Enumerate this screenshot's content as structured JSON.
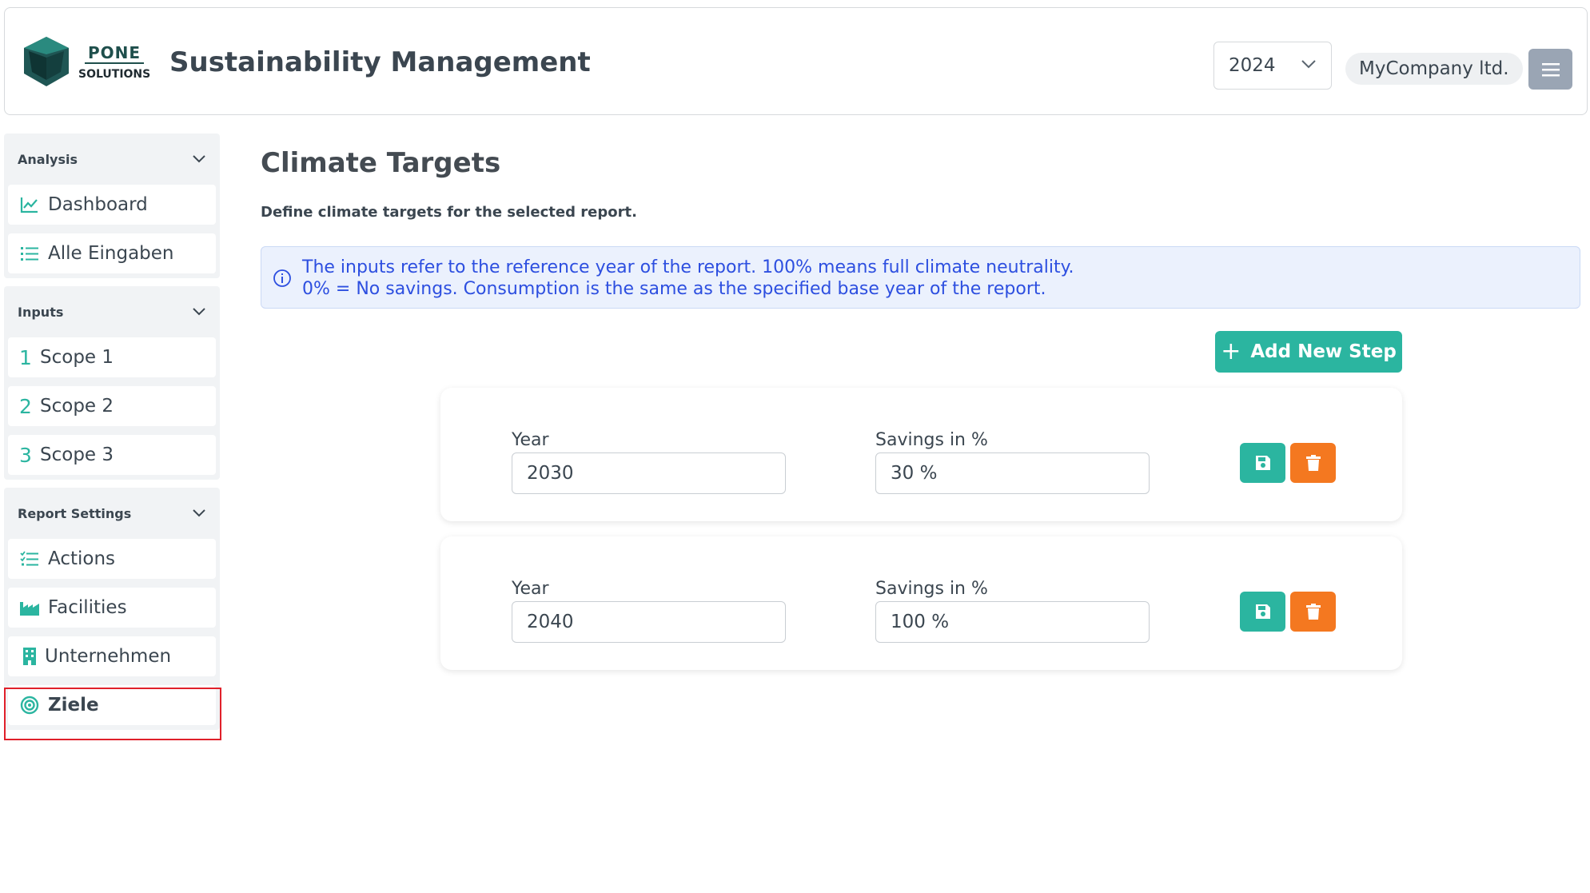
{
  "header": {
    "logo_top": "PONE",
    "logo_bottom": "SOLUTIONS",
    "title": "Sustainability Management",
    "year": "2024",
    "company": "MyCompany ltd."
  },
  "sidebar": {
    "sections": [
      {
        "title": "Analysis",
        "items": [
          {
            "label": "Dashboard",
            "icon": "chart-line-icon"
          },
          {
            "label": "Alle Eingaben",
            "icon": "list-icon"
          }
        ]
      },
      {
        "title": "Inputs",
        "items": [
          {
            "label": "Scope 1",
            "num": "1"
          },
          {
            "label": "Scope 2",
            "num": "2"
          },
          {
            "label": "Scope 3",
            "num": "3"
          }
        ]
      },
      {
        "title": "Report Settings",
        "items": [
          {
            "label": "Actions",
            "icon": "checklist-icon"
          },
          {
            "label": "Facilities",
            "icon": "industry-icon"
          },
          {
            "label": "Unternehmen",
            "icon": "building-icon"
          },
          {
            "label": "Ziele",
            "icon": "target-icon",
            "active": true
          }
        ]
      }
    ]
  },
  "main": {
    "title": "Climate Targets",
    "subtitle": "Define climate targets for the selected report.",
    "info_line1": "The inputs refer to the reference year of the report. 100% means full climate neutrality.",
    "info_line2": "0% = No savings. Consumption is the same as the specified base year of the report.",
    "add_button": "Add New Step",
    "steps": [
      {
        "year_label": "Year",
        "year": "2030",
        "savings_label": "Savings in %",
        "savings": "30 %"
      },
      {
        "year_label": "Year",
        "year": "2040",
        "savings_label": "Savings in %",
        "savings": "100 %"
      }
    ]
  },
  "colors": {
    "accent": "#2bb5a0",
    "danger": "#f47820",
    "info": "#2d4fe0",
    "highlight": "#e0202a"
  }
}
